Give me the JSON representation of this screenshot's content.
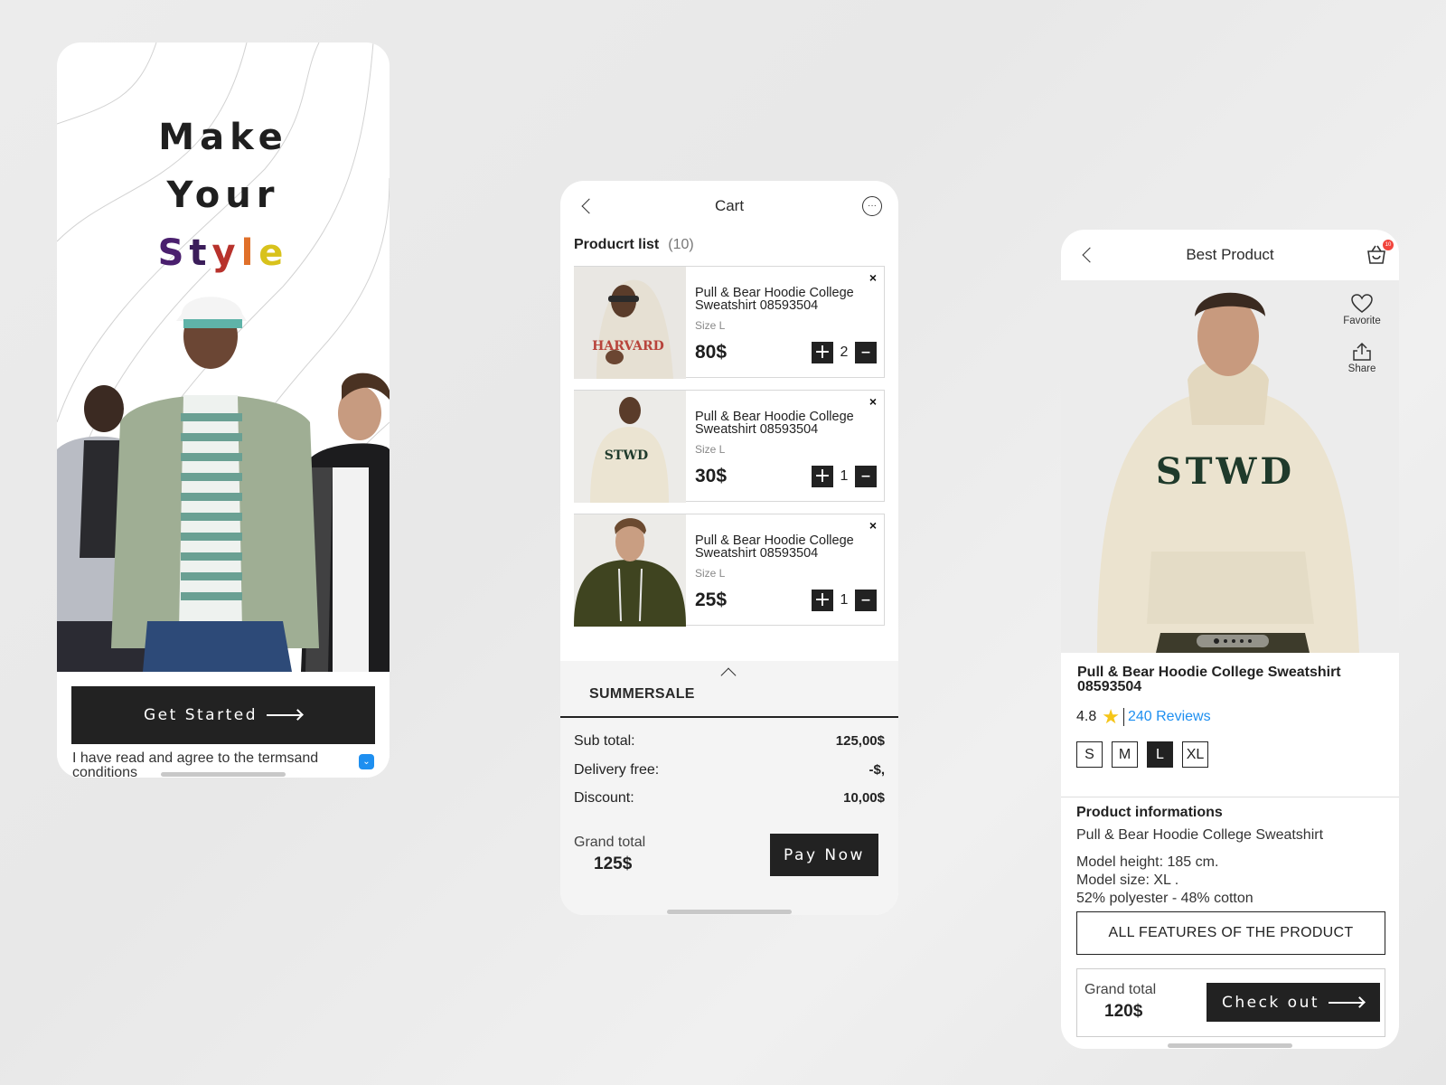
{
  "onboarding": {
    "title_lines": [
      "Make",
      "Your",
      "Style"
    ],
    "style_letters": [
      {
        "char": "S",
        "color": "#4a1f6e"
      },
      {
        "char": "t",
        "color": "#3b1d5a"
      },
      {
        "char": "y",
        "color": "#b8322c"
      },
      {
        "char": "l",
        "color": "#e0702a"
      },
      {
        "char": "e",
        "color": "#d8c21c"
      }
    ],
    "get_started_label": "Get Started",
    "terms_text": "I have read and agree to the termsand conditions",
    "terms_checked": true
  },
  "cart": {
    "title": "Cart",
    "list_label": "Producrt list",
    "list_count": "(10)",
    "items": [
      {
        "name": "Pull & Bear Hoodie College Sweatshirt 08593504",
        "size": "Size L",
        "price": "80$",
        "qty": "2",
        "print": "HARVARD"
      },
      {
        "name": "Pull & Bear Hoodie College Sweatshirt 08593504",
        "size": "Size L",
        "price": "30$",
        "qty": "1",
        "print": "STWD"
      },
      {
        "name": "Pull & Bear Hoodie College Sweatshirt 08593504",
        "size": "Size L",
        "price": "25$",
        "qty": "1",
        "print": ""
      }
    ],
    "promo_code": "SUMMERSALE",
    "summary": [
      {
        "label": "Sub total:",
        "value": "125,00$"
      },
      {
        "label": "Delivery free:",
        "value": "-$,"
      },
      {
        "label": "Discount:",
        "value": "10,00$"
      }
    ],
    "grand_total_label": "Grand total",
    "grand_total_value": "125$",
    "pay_label": "Pay Now"
  },
  "product": {
    "header_title": "Best Product",
    "cart_badge": "10",
    "favorite_label": "Favorite",
    "share_label": "Share",
    "hero_print": "STWD",
    "image_count": 5,
    "active_image": 1,
    "title": "Pull & Bear Hoodie College Sweatshirt 08593504",
    "rating": "4.8",
    "reviews": "240 Reviews",
    "sizes": [
      "S",
      "M",
      "L",
      "XL"
    ],
    "selected_size": "L",
    "info_heading": "Product informations",
    "info_subtitle": "Pull & Bear Hoodie College Sweatshirt",
    "info_lines": [
      "Model height: 185 cm.",
      "Model size: XL .",
      "52% polyester - 48% cotton"
    ],
    "features_label": "ALL FEATURES OF THE PRODUCT",
    "grand_total_label": "Grand total",
    "grand_total_value": "120$",
    "checkout_label": "Check out"
  }
}
